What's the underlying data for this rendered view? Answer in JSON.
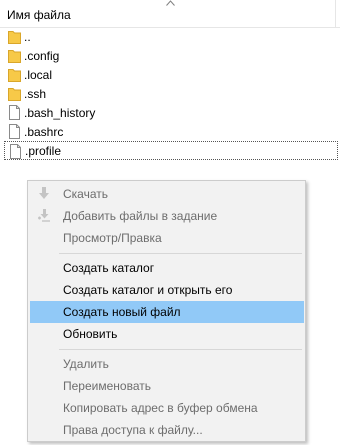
{
  "header": {
    "column_name": "Имя файла"
  },
  "files": [
    {
      "name": "..",
      "type": "folder"
    },
    {
      "name": ".config",
      "type": "folder"
    },
    {
      "name": ".local",
      "type": "folder"
    },
    {
      "name": ".ssh",
      "type": "folder"
    },
    {
      "name": ".bash_history",
      "type": "file"
    },
    {
      "name": ".bashrc",
      "type": "file"
    },
    {
      "name": ".profile",
      "type": "file",
      "focused": true
    }
  ],
  "context_menu": {
    "download": "Скачать",
    "add_to_queue": "Добавить файлы в задание",
    "view_edit": "Просмотр/Правка",
    "create_dir": "Создать каталог",
    "create_dir_open": "Создать каталог и открыть его",
    "create_file": "Создать новый файл",
    "refresh": "Обновить",
    "delete": "Удалить",
    "rename": "Переименовать",
    "copy_url": "Копировать адрес в буфер обмена",
    "permissions": "Права доступа к файлу..."
  },
  "colors": {
    "folder": "#f7c948",
    "highlight": "#91c9f7",
    "menu_bg": "#f2f2f2",
    "disabled_text": "#6d6d6d"
  }
}
